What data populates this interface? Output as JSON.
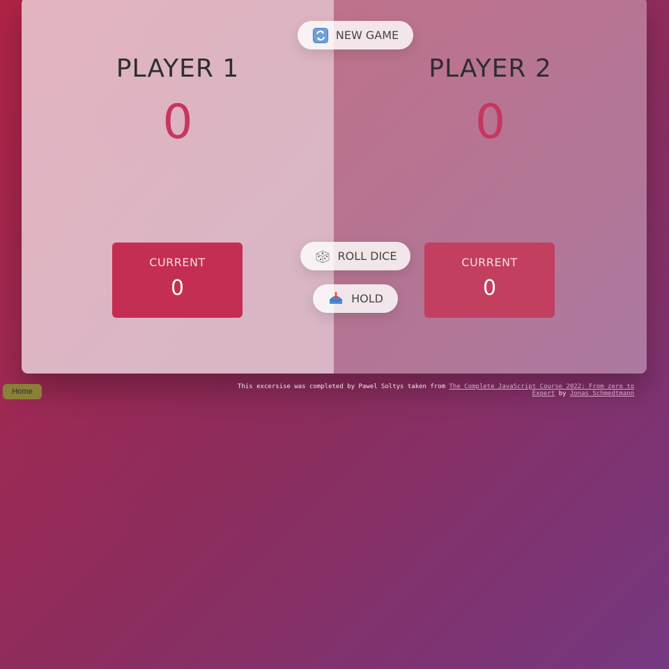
{
  "game": {
    "new_game_label": "NEW GAME",
    "roll_dice_label": "ROLL DICE",
    "hold_label": "HOLD",
    "players": [
      {
        "name": "PLAYER 1",
        "score": "0",
        "current_label": "CURRENT",
        "current_score": "0"
      },
      {
        "name": "PLAYER 2",
        "score": "0",
        "current_label": "CURRENT",
        "current_score": "0"
      }
    ],
    "icons": {
      "new_game": "refresh-icon",
      "roll_dice": "dice-icon",
      "hold": "inbox-tray-icon"
    }
  },
  "footer": {
    "home_label": "Home",
    "credit_prefix": "This excersise was completed by Pawel Soltys taken from ",
    "course_link": "The Complete JavaScript Course 2022: From zero to Expert",
    "credit_by": " by ",
    "author_link": "Jonas Schmedtmann"
  },
  "colors": {
    "accent": "#c7365f",
    "background_start": "#b52447",
    "background_end": "#743880",
    "home_button": "#8b8038"
  }
}
